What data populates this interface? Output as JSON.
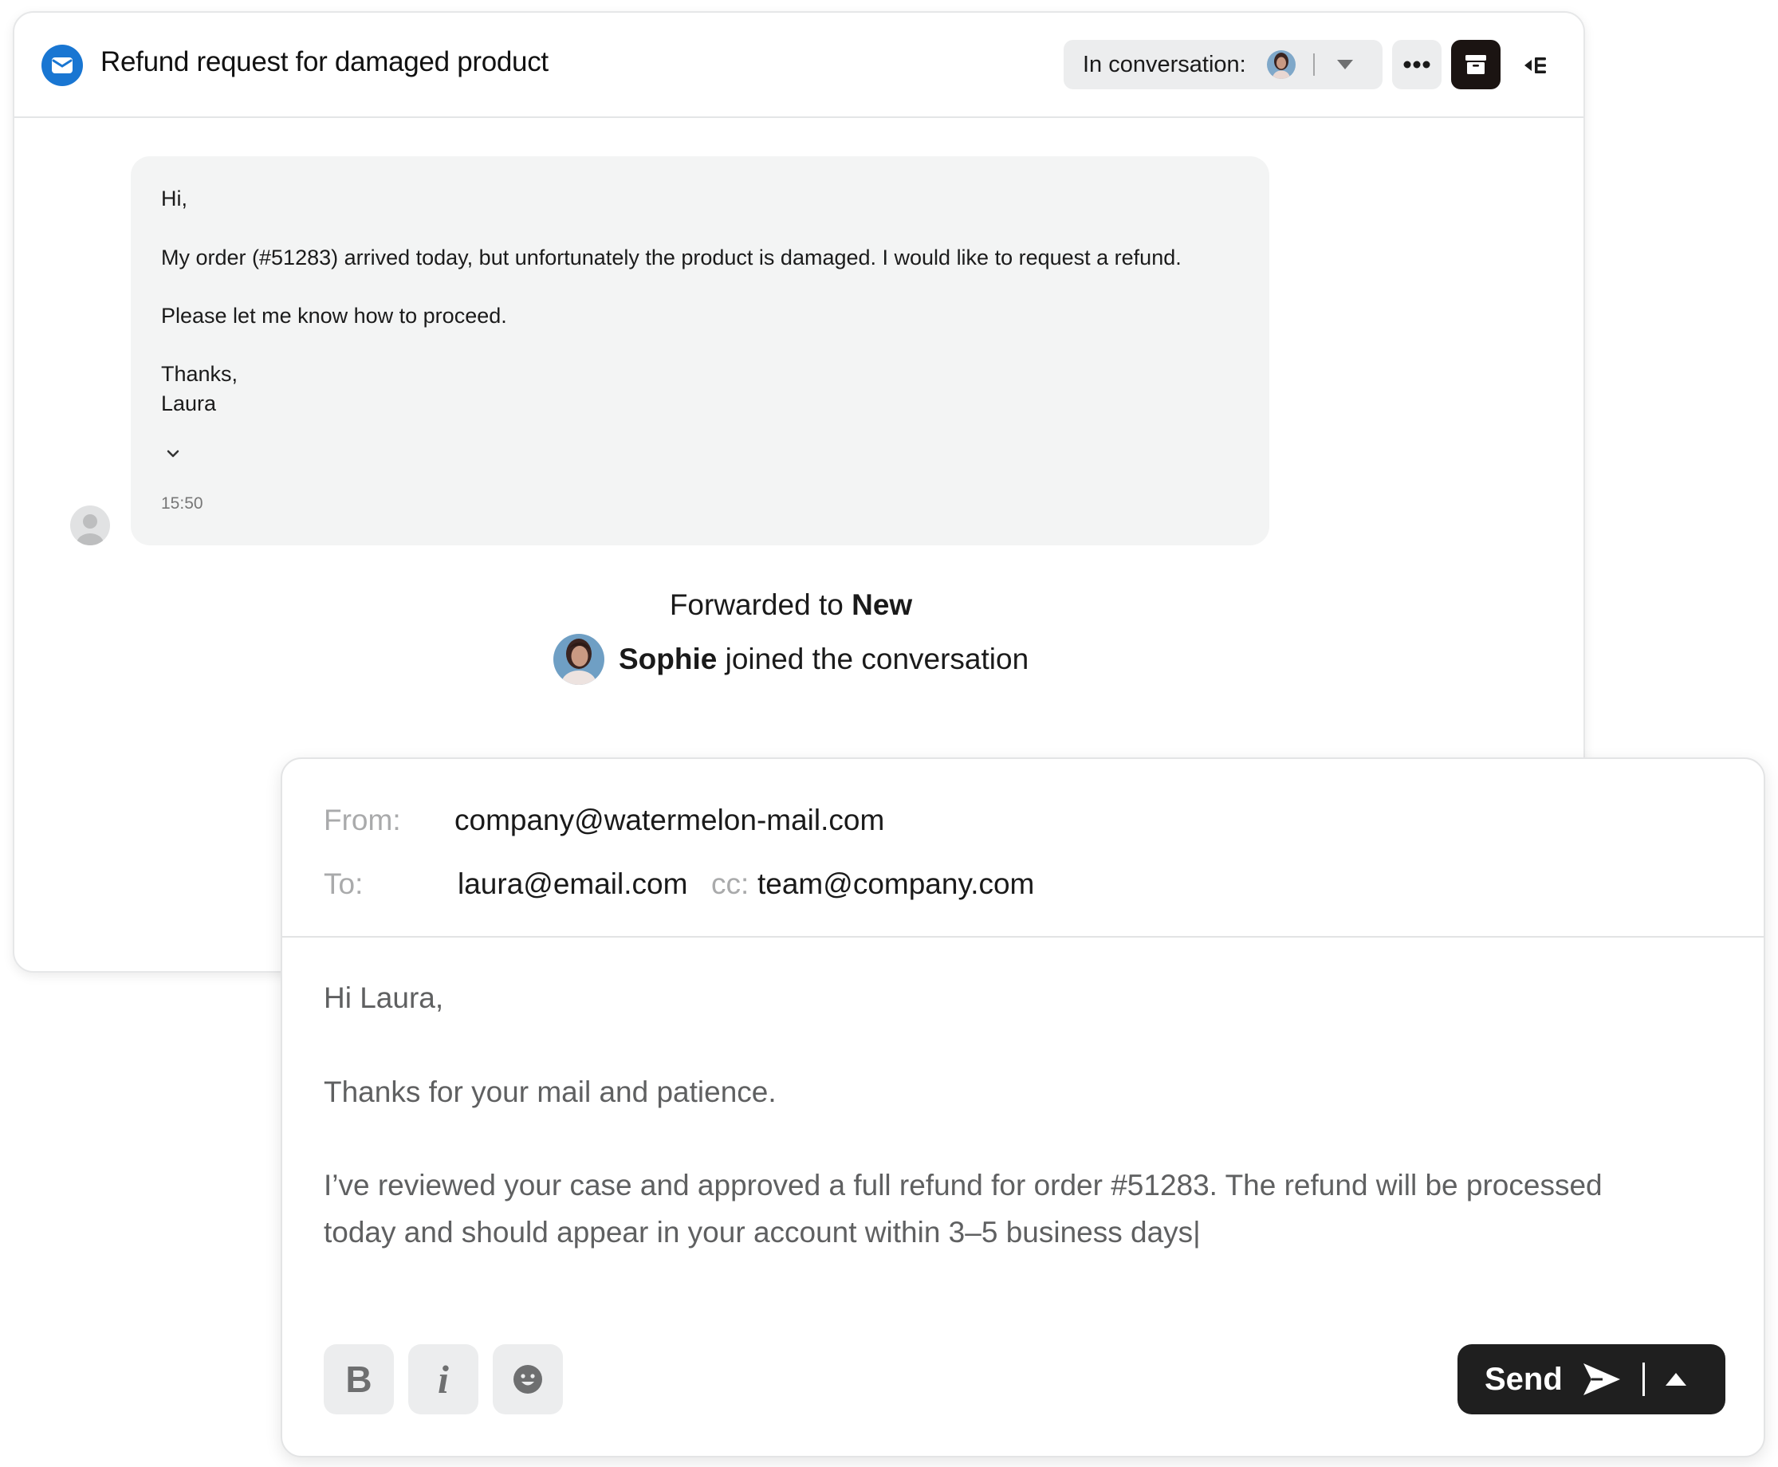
{
  "conversation": {
    "title": "Refund request for damaged product",
    "in_conversation_label": "In conversation:",
    "message": {
      "greeting": "Hi,",
      "body": "My order (#51283) arrived today, but unfortunately the product is damaged. I would like to request a refund.",
      "request": "Please let me know how to proceed.",
      "signoff": "Thanks,",
      "signature": "Laura",
      "time": "15:50"
    },
    "events": {
      "forwarded_prefix": "Forwarded to ",
      "forwarded_target": "New",
      "joined_name": "Sophie",
      "joined_suffix": " joined the conversation"
    }
  },
  "composer": {
    "from_label": "From:",
    "from_value": "company@watermelon-mail.com",
    "to_label": "To:",
    "to_value": "laura@email.com",
    "cc_label": "cc:",
    "cc_value": "team@company.com",
    "body_lines": [
      "Hi Laura,",
      "Thanks for your mail and patience.",
      "I’ve reviewed your case and approved a full refund for order #51283. The refund will be processed",
      "today and should appear in your account within 3–5 business days|"
    ],
    "bold_label": "B",
    "italic_label": "i",
    "send_label": "Send"
  },
  "icons": {
    "mail": "mail-icon",
    "more": "more-horizontal-icon",
    "archive": "archive-icon",
    "panel": "collapse-panel-icon",
    "dropdown": "caret-down-icon",
    "expand": "chevron-down-icon",
    "emoji": "emoji-icon",
    "send": "send-arrow-icon",
    "send_options": "caret-up-icon"
  },
  "colors": {
    "accent_blue": "#1976d2",
    "send_button": "#1f1f1f",
    "archive_button": "#1b1412",
    "message_bubble": "#f3f4f4"
  }
}
